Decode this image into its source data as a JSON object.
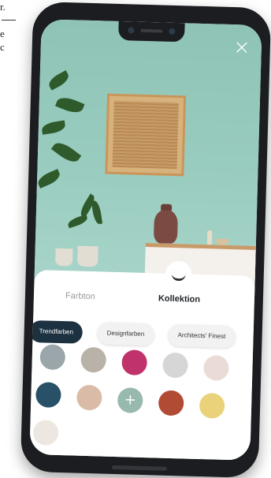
{
  "doc_margin": {
    "line_1": "r.",
    "line_3": "e",
    "line_4": "c"
  },
  "header": {
    "close_icon": "close-icon",
    "close_glyph": "×"
  },
  "tabs": [
    {
      "label": "Farbton",
      "active": false
    },
    {
      "label": "Kollektion",
      "active": true
    }
  ],
  "chips": [
    {
      "label": "Trendfarben",
      "active": true
    },
    {
      "label": "Designfarben",
      "active": false
    },
    {
      "label": "Architects' Finest",
      "active": false
    }
  ],
  "swatches": {
    "row_1": [
      "#9aa6aa",
      "#b9b2a8",
      "#c0336a",
      "#d6d6d6",
      "#eadbd6"
    ],
    "row_2": [
      "#285067",
      "#d9bba8",
      "#98b9ae",
      "#b24b33",
      "#e9d27a"
    ],
    "row_3": [
      "#ece8e1"
    ],
    "add_icon": "plus-icon",
    "add_glyph": "+"
  },
  "colors": {
    "wall": "#9acdc0",
    "active_chip": "#1d3241",
    "phone_frame": "#1b1d20"
  }
}
